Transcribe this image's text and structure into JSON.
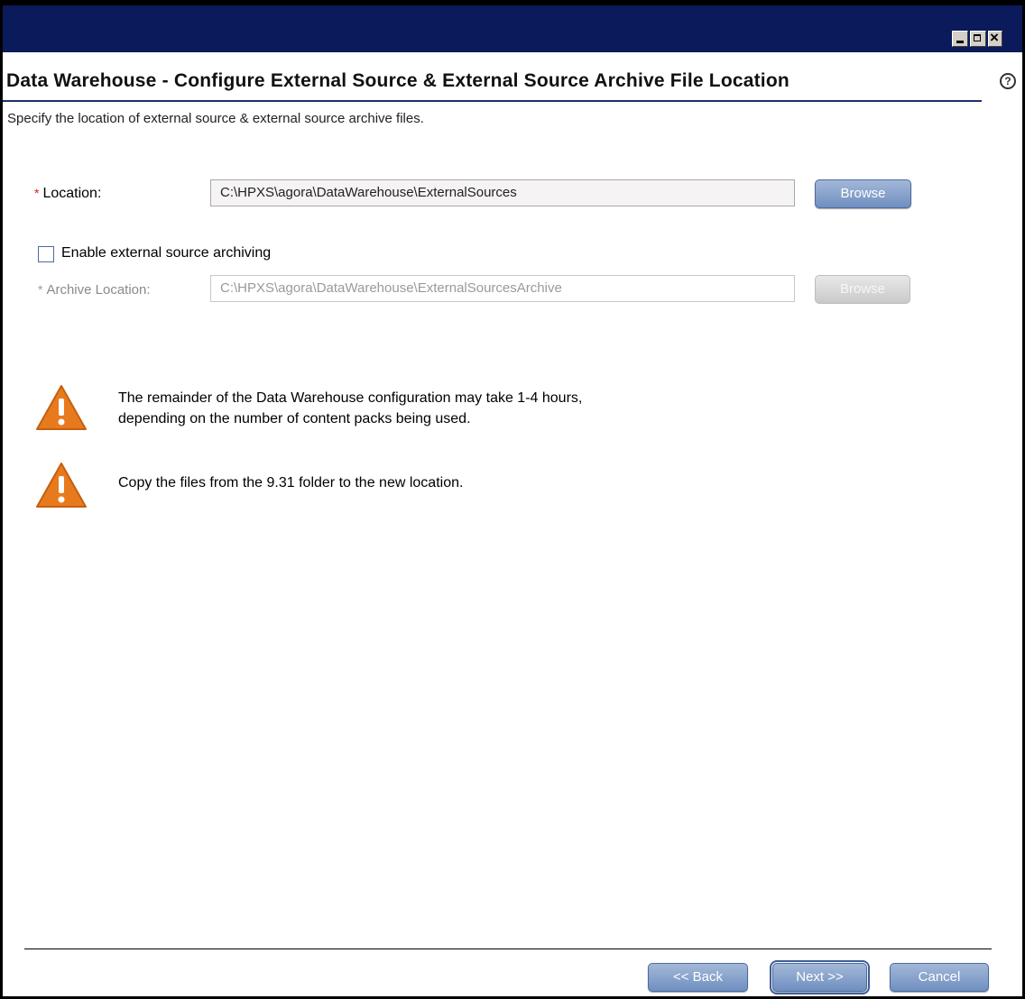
{
  "window": {
    "controls": [
      "minimize",
      "maximize",
      "close"
    ]
  },
  "header": {
    "title": "Data Warehouse - Configure External Source & External Source Archive File Location",
    "subtitle": "Specify the location of external source & external source archive files.",
    "help_icon": "help-icon"
  },
  "form": {
    "location": {
      "required_mark": "*",
      "label": "Location:",
      "value": "C:\\HPXS\\agora\\DataWarehouse\\ExternalSources",
      "browse_label": "Browse"
    },
    "archiving_checkbox": {
      "label": "Enable external source archiving",
      "checked": false
    },
    "archive_location": {
      "required_mark": "*",
      "label": "Archive Location:",
      "value": "C:\\HPXS\\agora\\DataWarehouse\\ExternalSourcesArchive",
      "browse_label": "Browse",
      "disabled": true
    }
  },
  "warnings": [
    {
      "icon": "warning-icon",
      "lines": [
        "The remainder of the Data Warehouse configuration may take 1-4 hours,",
        "depending on the number of content packs being used."
      ]
    },
    {
      "icon": "warning-icon",
      "lines": [
        "Copy the files from the 9.31 folder to the new location."
      ]
    }
  ],
  "footer": {
    "back_label": "<< Back",
    "next_label": "Next >>",
    "cancel_label": "Cancel"
  },
  "colors": {
    "titlebar": "#0a1a5a",
    "required": "#cc2222",
    "warning": "#e87a1e",
    "button": "#7b98c8"
  }
}
